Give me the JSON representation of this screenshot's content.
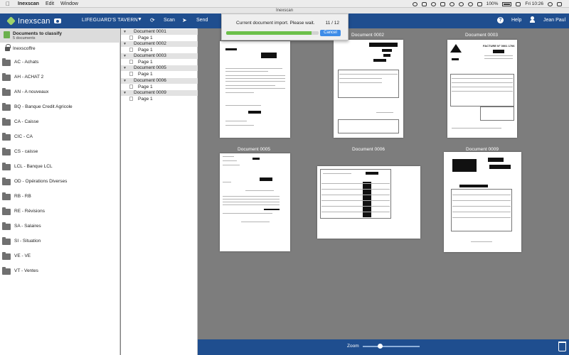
{
  "menubar": {
    "app_name": "Inexscan",
    "items": [
      "Edit",
      "Window"
    ],
    "battery": "100%",
    "clock": "Fri 10:26"
  },
  "window": {
    "title": "Inexscan"
  },
  "toolbar": {
    "logo_text": "Inexscan",
    "client": "LIFEGUARD'S TAVERN",
    "scan_label": "Scan",
    "send_label": "Send",
    "help_label": "Help",
    "user_name": "Jean Paul"
  },
  "sidebar": {
    "classify_title": "Documents to classify",
    "classify_count": "5 documents",
    "coffre_label": "Inexscoffre",
    "folders": [
      "AC  -  Achats",
      "AH  -  ACHAT 2",
      "AN  -  A nouveaux",
      "BQ  -  Banque Credit Agricole",
      "CA  -  Caisse",
      "CIC  -  CA",
      "CS  -  caisse",
      "LCL  -  Banque LCL",
      "OD  -  Opérations Diverses",
      "RB  -  RB",
      "RE  -  Révisions",
      "SA  -  Salaires",
      "SI  -  Situation",
      "VE  -  VE",
      "VT  -  Ventes"
    ]
  },
  "tree": {
    "documents": [
      {
        "name": "Document 0001",
        "page": "Page 1"
      },
      {
        "name": "Document 0002",
        "page": "Page 1"
      },
      {
        "name": "Document 0003",
        "page": "Page 1"
      },
      {
        "name": "Document 0005",
        "page": "Page 1"
      },
      {
        "name": "Document 0006",
        "page": "Page 1"
      },
      {
        "name": "Document 0009",
        "page": "Page 1"
      }
    ]
  },
  "thumbnails": {
    "labels": [
      "Document 0002",
      "Document 0003",
      "Document 0005",
      "Document 0006",
      "Document 0009"
    ],
    "invoice_title": "FACTURE N° 0001 1706"
  },
  "dialog": {
    "message": "Current document import. Please wait.",
    "count": "11 / 12",
    "progress": 0.92,
    "cancel_label": "Cancel"
  },
  "bottombar": {
    "zoom_label": "Zoom",
    "zoom_level": 0.3
  },
  "colors": {
    "toolbar_blue": "#1f4e8f",
    "accent_green": "#6cc04a",
    "cancel_blue": "#3d8ce8"
  }
}
